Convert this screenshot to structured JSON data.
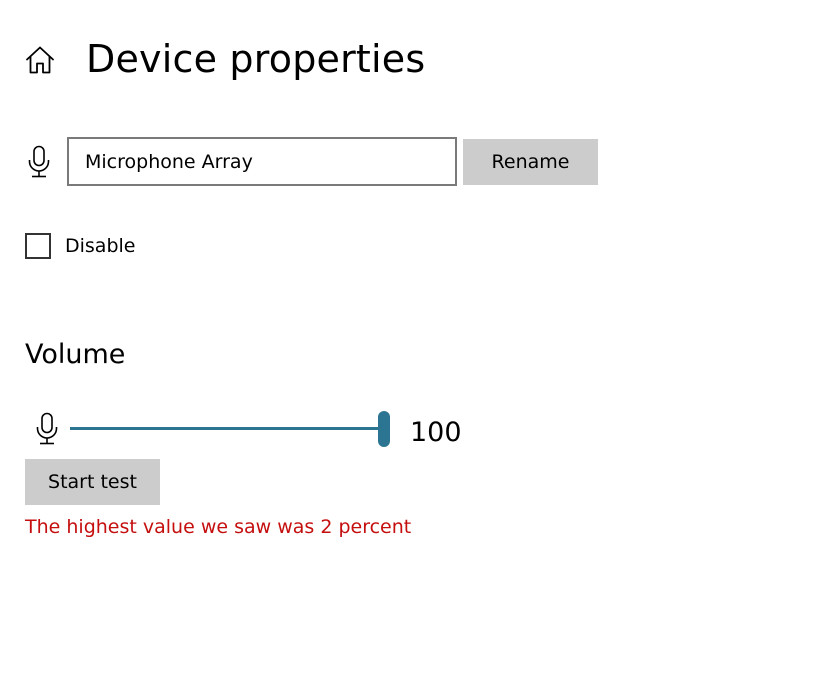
{
  "header": {
    "title": "Device properties",
    "home_icon": "home-icon"
  },
  "device": {
    "icon": "microphone-icon",
    "name_value": "Microphone Array",
    "rename_label": "Rename"
  },
  "disable": {
    "label": "Disable",
    "checked": false
  },
  "volume": {
    "heading": "Volume",
    "icon": "microphone-icon",
    "value": 100,
    "display": "100",
    "min": 0,
    "max": 100
  },
  "test": {
    "button_label": "Start test",
    "result_text": "The highest value we saw was 2 percent"
  },
  "colors": {
    "accent": "#2c7592",
    "result_text": "#c50f0f",
    "button_bg": "#cccccc",
    "input_border": "#7a7a7a"
  }
}
